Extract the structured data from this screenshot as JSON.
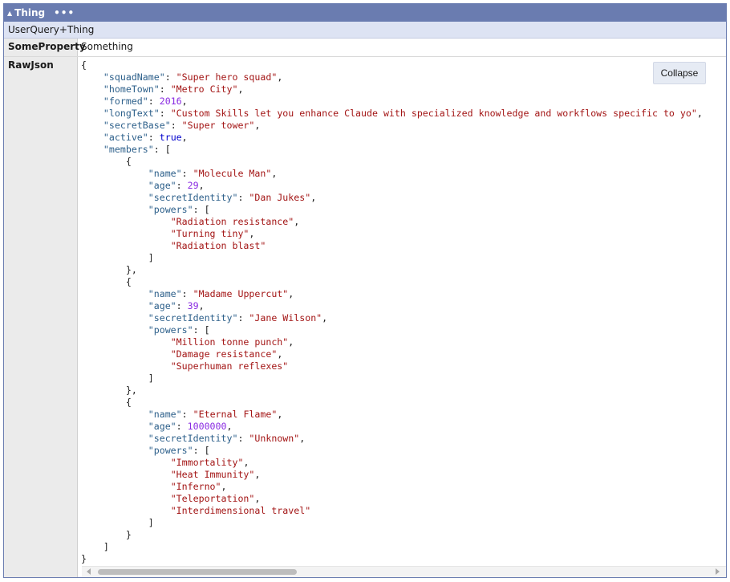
{
  "header": {
    "title": "Thing",
    "menu_icon": "ellipsis-icon",
    "collapse_icon": "triangle-up-icon"
  },
  "type_name": "UserQuery+Thing",
  "properties": [
    {
      "key": "SomeProperty",
      "value": "Something"
    },
    {
      "key": "RawJson"
    }
  ],
  "collapse_label": "Collapse",
  "json": {
    "squadName": "Super hero squad",
    "homeTown": "Metro City",
    "formed": 2016,
    "longText": "Custom Skills let you enhance Claude with specialized knowledge and workflows specific to yo",
    "secretBase": "Super tower",
    "active": true,
    "members": [
      {
        "name": "Molecule Man",
        "age": 29,
        "secretIdentity": "Dan Jukes",
        "powers": [
          "Radiation resistance",
          "Turning tiny",
          "Radiation blast"
        ]
      },
      {
        "name": "Madame Uppercut",
        "age": 39,
        "secretIdentity": "Jane Wilson",
        "powers": [
          "Million tonne punch",
          "Damage resistance",
          "Superhuman reflexes"
        ]
      },
      {
        "name": "Eternal Flame",
        "age": 1000000,
        "secretIdentity": "Unknown",
        "powers": [
          "Immortality",
          "Heat Immunity",
          "Inferno",
          "Teleportation",
          "Interdimensional travel"
        ]
      }
    ]
  },
  "colors": {
    "header_bg": "#6a7cb0",
    "type_bg": "#dde3f3",
    "key": "#2c5f8a",
    "string": "#a31515",
    "number": "#8a2be2",
    "bool": "#0000cc"
  }
}
